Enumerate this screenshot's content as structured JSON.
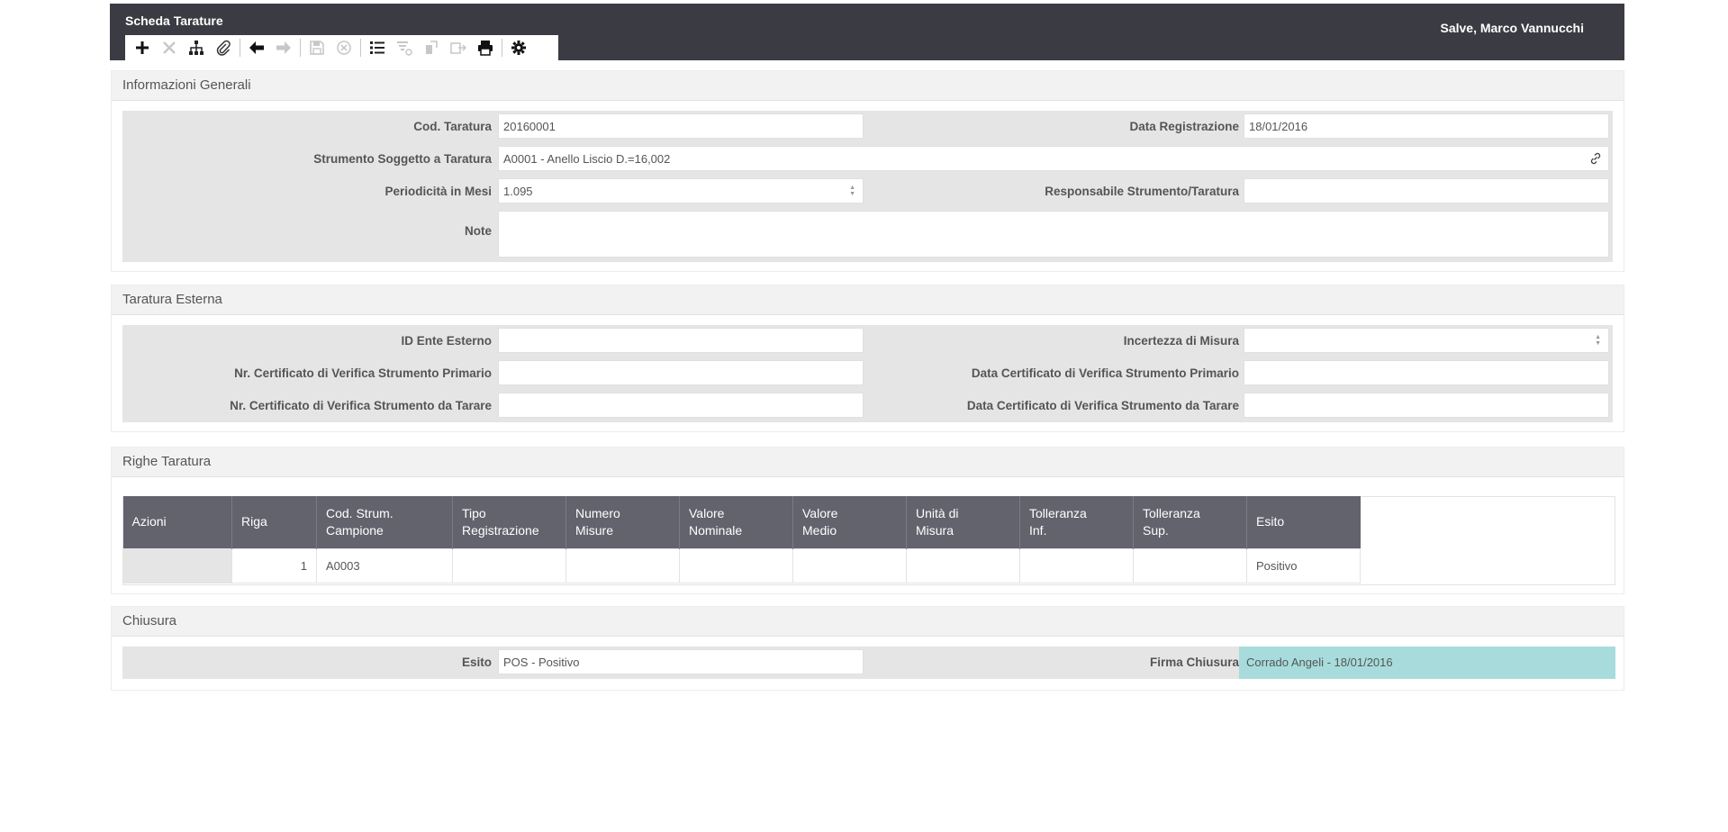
{
  "header": {
    "title": "Scheda Tarature",
    "greeting": "Salve, Marco Vannucchi"
  },
  "toolbar": {
    "items": [
      {
        "icon": "plus-icon",
        "enabled": true
      },
      {
        "icon": "close-icon",
        "enabled": false
      },
      {
        "icon": "hierarchy-icon",
        "enabled": true
      },
      {
        "icon": "paperclip-icon",
        "enabled": true
      },
      {
        "icon": "arrow-left-icon",
        "enabled": true
      },
      {
        "icon": "arrow-right-icon",
        "enabled": false
      },
      {
        "icon": "save-icon",
        "enabled": false
      },
      {
        "icon": "cancel-circle-icon",
        "enabled": false
      },
      {
        "icon": "list-icon",
        "enabled": true
      },
      {
        "icon": "filter-icon",
        "enabled": false
      },
      {
        "icon": "export-icon",
        "enabled": false
      },
      {
        "icon": "share-icon",
        "enabled": false
      },
      {
        "icon": "print-icon",
        "enabled": true
      },
      {
        "icon": "gear-icon",
        "enabled": true
      }
    ]
  },
  "general": {
    "title": "Informazioni Generali",
    "cod_taratura": {
      "label": "Cod. Taratura",
      "value": "20160001"
    },
    "data_registrazione": {
      "label": "Data Registrazione",
      "value": "18/01/2016"
    },
    "strumento": {
      "label": "Strumento Soggetto a Taratura",
      "value": "A0001 - Anello Liscio D.=16,002"
    },
    "periodicita": {
      "label": "Periodicità in Mesi",
      "value": "1.095"
    },
    "responsabile": {
      "label": "Responsabile Strumento/Taratura",
      "value": ""
    },
    "note": {
      "label": "Note",
      "value": ""
    }
  },
  "external": {
    "title": "Taratura Esterna",
    "id_ente": {
      "label": "ID Ente Esterno",
      "value": ""
    },
    "incertezza": {
      "label": "Incertezza di Misura",
      "value": ""
    },
    "nr_cert_primario": {
      "label": "Nr. Certificato di Verifica Strumento Primario",
      "value": ""
    },
    "data_cert_primario": {
      "label": "Data Certificato di Verifica Strumento Primario",
      "value": ""
    },
    "nr_cert_tarare": {
      "label": "Nr. Certificato di Verifica Strumento da Tarare",
      "value": ""
    },
    "data_cert_tarare": {
      "label": "Data Certificato di Verifica Strumento da Tarare",
      "value": ""
    }
  },
  "rows_section": {
    "title": "Righe Taratura",
    "columns": [
      {
        "line1": "Azioni",
        "line2": ""
      },
      {
        "line1": "Riga",
        "line2": ""
      },
      {
        "line1": "Cod. Strum.",
        "line2": "Campione"
      },
      {
        "line1": "Tipo",
        "line2": "Registrazione"
      },
      {
        "line1": "Numero",
        "line2": "Misure"
      },
      {
        "line1": "Valore",
        "line2": "Nominale"
      },
      {
        "line1": "Valore",
        "line2": "Medio"
      },
      {
        "line1": "Unità di",
        "line2": "Misura"
      },
      {
        "line1": "Tolleranza",
        "line2": "Inf."
      },
      {
        "line1": "Tolleranza",
        "line2": "Sup."
      },
      {
        "line1": "Esito",
        "line2": ""
      }
    ],
    "rows": [
      {
        "cells": [
          "",
          "1",
          "A0003",
          "",
          "",
          "",
          "",
          "",
          "",
          "",
          "Positivo"
        ]
      }
    ]
  },
  "closing": {
    "title": "Chiusura",
    "esito": {
      "label": "Esito",
      "value": "POS - Positivo"
    },
    "firma": {
      "label": "Firma Chiusura",
      "value": "Corrado Angeli - 18/01/2016"
    }
  },
  "colors": {
    "header_bg": "#3b3c43",
    "table_header_bg": "#62636d",
    "signature_bg": "#a8dcdc"
  }
}
